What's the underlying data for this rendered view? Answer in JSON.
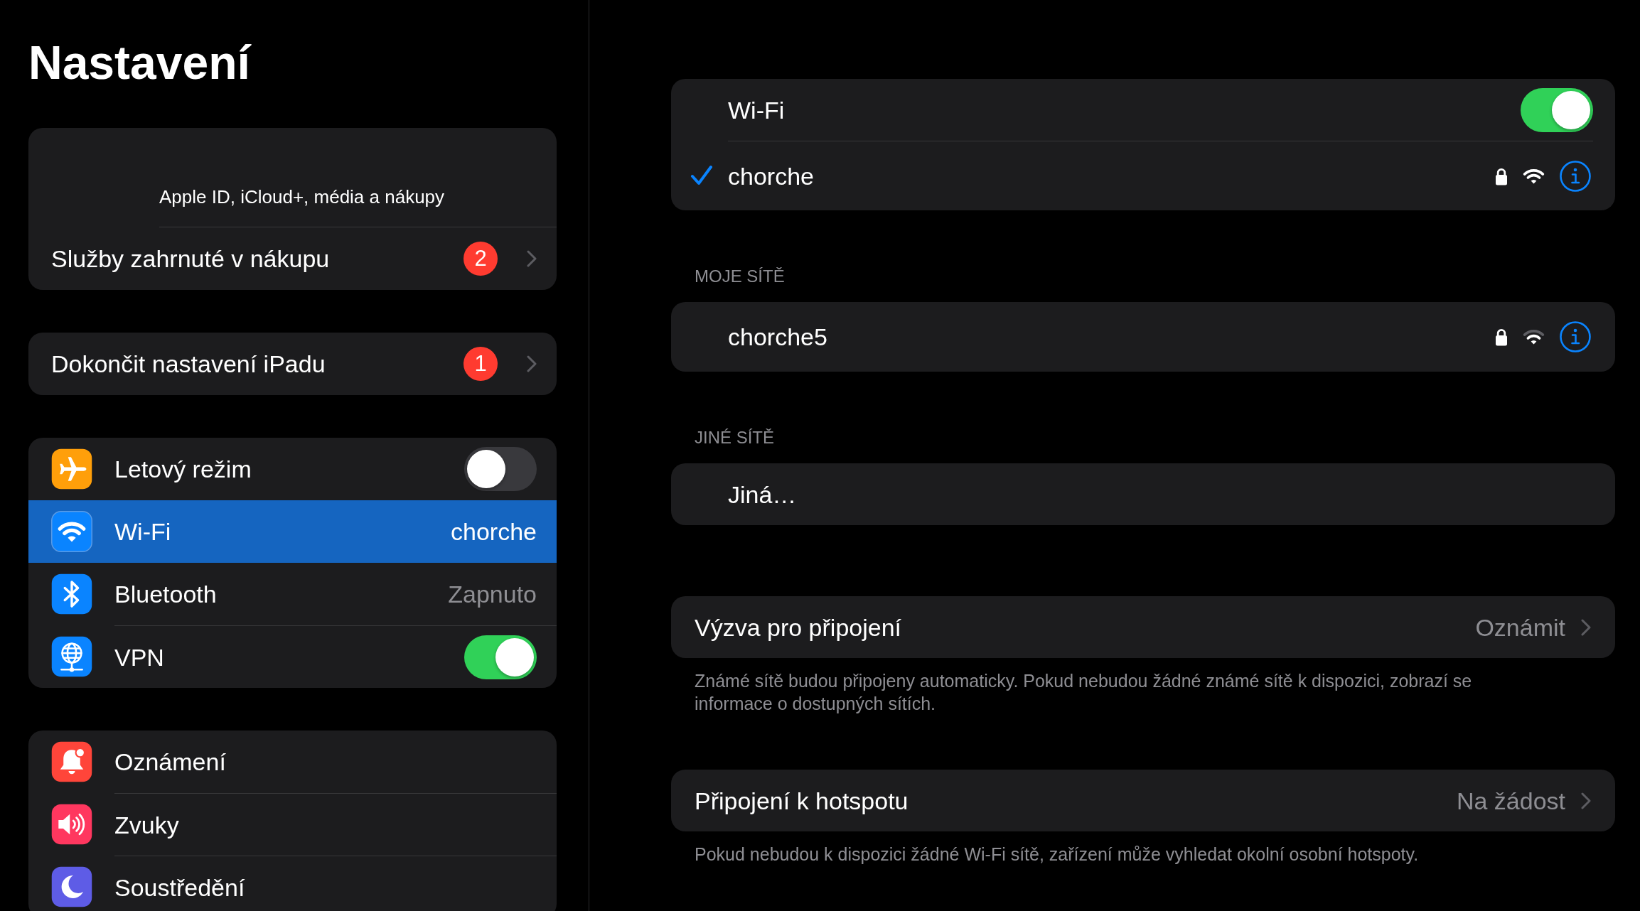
{
  "sidebar": {
    "title": "Nastavení",
    "groups": [
      {
        "items": [
          {
            "kind": "account",
            "subtitle": "Apple ID, iCloud+, média a nákupy",
            "selected": false
          },
          {
            "kind": "badge",
            "label": "Služby zahrnuté v nákupu",
            "badge": "2",
            "selected": false
          }
        ]
      },
      {
        "items": [
          {
            "kind": "badge",
            "label": "Dokončit nastavení iPadu",
            "badge": "1",
            "selected": false
          }
        ]
      },
      {
        "items": [
          {
            "kind": "toggle",
            "label": "Letový režim",
            "on": false,
            "selected": false
          },
          {
            "kind": "detail",
            "label": "Wi-Fi",
            "value": "chorche",
            "selected": true
          },
          {
            "kind": "detail",
            "label": "Bluetooth",
            "value": "Zapnuto",
            "selected": false
          },
          {
            "kind": "toggle",
            "label": "VPN",
            "on": true,
            "selected": false
          }
        ]
      },
      {
        "items": [
          {
            "kind": "plain",
            "label": "Oznámení",
            "selected": false
          },
          {
            "kind": "plain",
            "label": "Zvuky",
            "selected": false
          },
          {
            "kind": "plain",
            "label": "Soustředění",
            "selected": false
          }
        ]
      }
    ]
  },
  "wifi": {
    "switch_row": {
      "label": "Wi-Fi",
      "on": true
    },
    "current_network": {
      "name": "chorche",
      "connected": true,
      "secured": true
    },
    "sections": [
      {
        "header": "MOJE SÍTĚ",
        "networks": [
          {
            "kind": "network",
            "name": "chorche5",
            "connected": false,
            "secured": true
          }
        ]
      },
      {
        "header": "JINÉ SÍTĚ",
        "networks": [
          {
            "kind": "other",
            "name": "Jiná…"
          }
        ]
      }
    ],
    "options": [
      {
        "label": "Výzva pro připojení",
        "value": "Oznámit",
        "footer": "Známé sítě budou připojeny automaticky. Pokud nebudou žádné známé sítě k dispozici, zobrazí se informace o dostupných sítích."
      },
      {
        "label": "Připojení k hotspotu",
        "value": "Na žádost",
        "footer": "Pokud nebudou k dispozici žádné Wi-Fi sítě, zařízení může vyhledat okolní osobní hotspoty."
      }
    ]
  }
}
